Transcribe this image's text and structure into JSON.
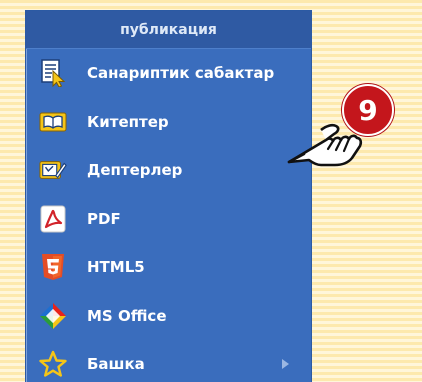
{
  "menu": {
    "header": "публикация",
    "items": [
      {
        "label": "Санариптик сабактар",
        "icon": "document-cursor-icon"
      },
      {
        "label": "Китептер",
        "icon": "book-icon"
      },
      {
        "label": "Дептерлер",
        "icon": "notebook-pen-icon"
      },
      {
        "label": "PDF",
        "icon": "pdf-icon"
      },
      {
        "label": "HTML5",
        "icon": "html5-icon"
      },
      {
        "label": "MS Office",
        "icon": "ms-office-icon"
      },
      {
        "label": "Башка",
        "icon": "star-icon",
        "has_submenu": true
      }
    ]
  },
  "badge": {
    "number": "9"
  },
  "colors": {
    "menu_bg": "#3a6dbd",
    "menu_header_bg": "#2f5aa3",
    "badge_bg": "#c4161c",
    "background_stripe_a": "#fde9ad",
    "background_stripe_b": "#fff6da"
  }
}
